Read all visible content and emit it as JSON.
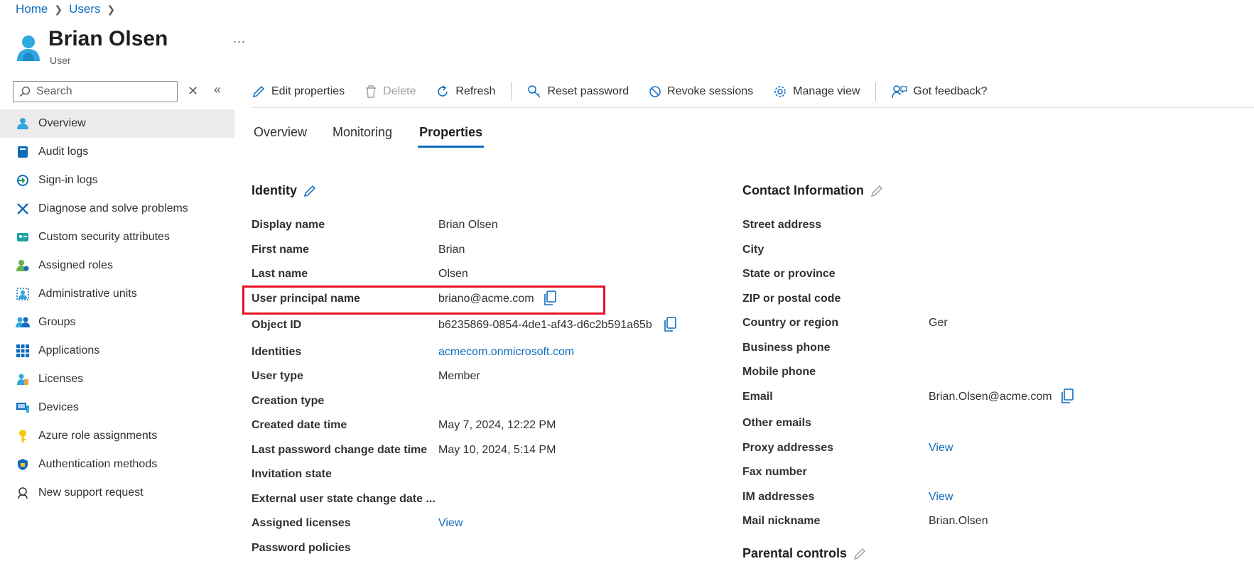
{
  "breadcrumb": {
    "home": "Home",
    "users": "Users"
  },
  "header": {
    "title": "Brian Olsen",
    "subtitle": "User",
    "more": "..."
  },
  "sidebar": {
    "search_placeholder": "Search",
    "items": [
      {
        "label": "Overview",
        "icon": "user-icon"
      },
      {
        "label": "Audit logs",
        "icon": "audit-log-icon"
      },
      {
        "label": "Sign-in logs",
        "icon": "sign-in-icon"
      },
      {
        "label": "Diagnose and solve problems",
        "icon": "wrench-icon"
      },
      {
        "label": "Custom security attributes",
        "icon": "security-attributes-icon"
      },
      {
        "label": "Assigned roles",
        "icon": "assigned-roles-icon"
      },
      {
        "label": "Administrative units",
        "icon": "admin-units-icon"
      },
      {
        "label": "Groups",
        "icon": "groups-icon"
      },
      {
        "label": "Applications",
        "icon": "applications-grid-icon"
      },
      {
        "label": "Licenses",
        "icon": "licenses-icon"
      },
      {
        "label": "Devices",
        "icon": "devices-icon"
      },
      {
        "label": "Azure role assignments",
        "icon": "key-icon"
      },
      {
        "label": "Authentication methods",
        "icon": "shield-icon"
      },
      {
        "label": "New support request",
        "icon": "support-icon"
      }
    ]
  },
  "toolbar": {
    "edit": "Edit properties",
    "delete": "Delete",
    "refresh": "Refresh",
    "reset_password": "Reset password",
    "revoke_sessions": "Revoke sessions",
    "manage_view": "Manage view",
    "feedback": "Got feedback?"
  },
  "tabs": [
    "Overview",
    "Monitoring",
    "Properties"
  ],
  "identity": {
    "title": "Identity",
    "rows": [
      {
        "label": "Display name",
        "value": "Brian Olsen"
      },
      {
        "label": "First name",
        "value": "Brian"
      },
      {
        "label": "Last name",
        "value": "Olsen"
      },
      {
        "label": "User principal name",
        "value": "briano@acme.com"
      },
      {
        "label": "Object ID",
        "value": "b6235869-0854-4de1-af43-d6c2b591a65b"
      },
      {
        "label": "Identities",
        "value": "acmecom.onmicrosoft.com"
      },
      {
        "label": "User type",
        "value": "Member"
      },
      {
        "label": "Creation type",
        "value": ""
      },
      {
        "label": "Created date time",
        "value": "May 7, 2024, 12:22 PM"
      },
      {
        "label": "Last password change date time",
        "value": "May 10, 2024, 5:14 PM"
      },
      {
        "label": "Invitation state",
        "value": ""
      },
      {
        "label": "External user state change date ...",
        "value": ""
      },
      {
        "label": "Assigned licenses",
        "value": "View"
      },
      {
        "label": "Password policies",
        "value": ""
      }
    ]
  },
  "contact": {
    "title": "Contact Information",
    "rows": [
      {
        "label": "Street address",
        "value": ""
      },
      {
        "label": "City",
        "value": ""
      },
      {
        "label": "State or province",
        "value": ""
      },
      {
        "label": "ZIP or postal code",
        "value": ""
      },
      {
        "label": "Country or region",
        "value": "Ger"
      },
      {
        "label": "Business phone",
        "value": ""
      },
      {
        "label": "Mobile phone",
        "value": ""
      },
      {
        "label": "Email",
        "value": "Brian.Olsen@acme.com"
      },
      {
        "label": "Other emails",
        "value": ""
      },
      {
        "label": "Proxy addresses",
        "value": "View"
      },
      {
        "label": "Fax number",
        "value": ""
      },
      {
        "label": "IM addresses",
        "value": "View"
      },
      {
        "label": "Mail nickname",
        "value": "Brian.Olsen"
      }
    ]
  },
  "parental": {
    "title": "Parental controls"
  },
  "colors": {
    "accent": "#0f6cbd",
    "highlight": "#e81123",
    "active_nav": "#edebe9"
  }
}
